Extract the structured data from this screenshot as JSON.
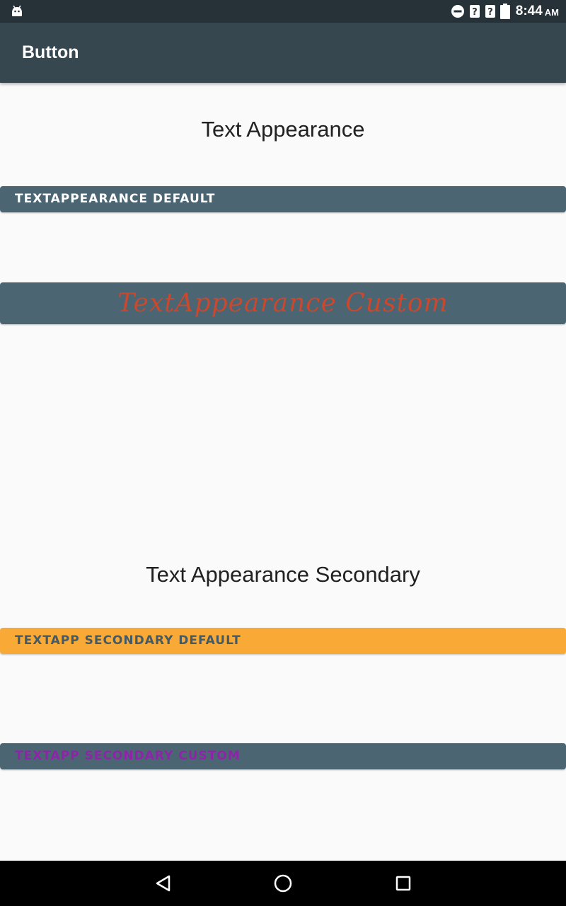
{
  "status_bar": {
    "time": "8:44",
    "ampm": "AM",
    "icons": [
      "android-icon",
      "do-not-disturb-icon",
      "unknown-signal-icon",
      "unknown-signal-icon",
      "battery-icon"
    ]
  },
  "app_bar": {
    "title": "Button"
  },
  "section_primary": {
    "title": "Text Appearance",
    "default_button": "TEXTAPPEARANCE DEFAULT",
    "custom_button": "TextAppearance Custom"
  },
  "section_secondary": {
    "title": "Text Appearance Secondary",
    "default_button": "TEXTAPP SECONDARY DEFAULT",
    "custom_button": "TEXTAPP SECONDARY CUSTOM"
  },
  "nav_bar": {
    "icons": [
      "back-icon",
      "home-icon",
      "recents-icon"
    ]
  },
  "colors": {
    "status_bar": "#263238",
    "app_bar": "#37474f",
    "button_primary": "#4b6572",
    "button_secondary": "#f9a935",
    "custom_text_primary": "#c9482e",
    "custom_text_secondary": "#8e24aa"
  }
}
